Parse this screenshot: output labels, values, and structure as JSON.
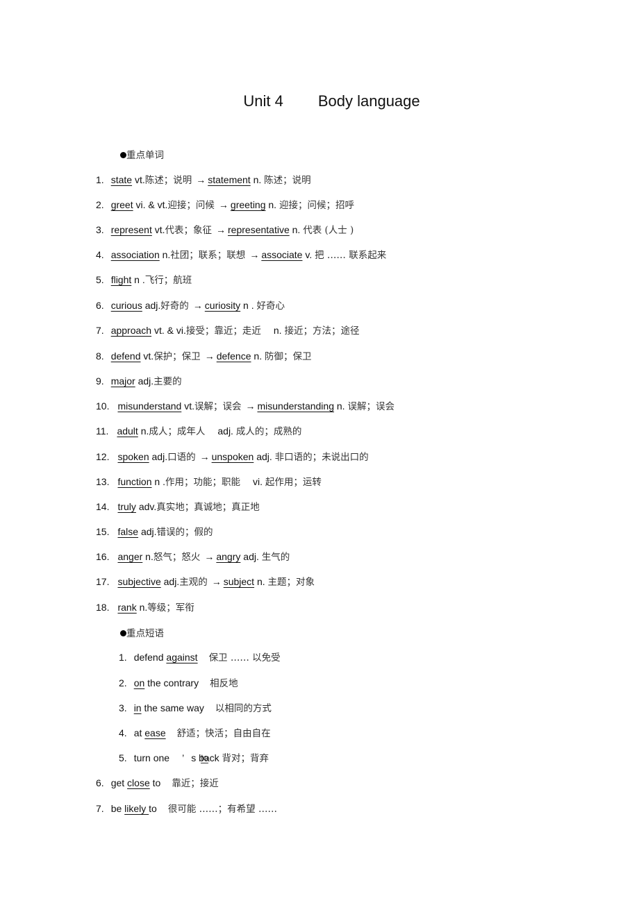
{
  "title": {
    "unit": "Unit 4",
    "topic": "Body language"
  },
  "sections": {
    "words_heading": "重点单词",
    "phrases_heading": "重点短语"
  },
  "words": [
    {
      "num": "1.",
      "word": "state",
      "pos": "vt.",
      "meaning": "陈述；说明",
      "arrow": "→",
      "derived": "statement",
      "dpos": "n.",
      "dmeaning": "陈述；说明"
    },
    {
      "num": "2.",
      "word": "greet",
      "pos": "vi. & vt.",
      "meaning": "迎接；问候",
      "arrow": "→",
      "derived": "greeting",
      "dpos": "n.",
      "dmeaning": "迎接；问候；招呼"
    },
    {
      "num": "3.",
      "word": "represent",
      "pos": "vt.",
      "meaning": "代表；象征",
      "arrow": "→",
      "derived": "representative",
      "dpos": "n.",
      "dmeaning": "代表 (人士 )"
    },
    {
      "num": "4.",
      "word": "association",
      "pos": "n.",
      "meaning": "社团；联系；联想",
      "arrow": "→",
      "derived": "associate",
      "dpos": "v.",
      "dmeaning": "把 …… 联系起来"
    },
    {
      "num": "5.",
      "word": "flight",
      "pos": "n .",
      "meaning": "飞行；航班"
    },
    {
      "num": "6.",
      "word": "curious",
      "pos": "adj.",
      "meaning": "好奇的",
      "arrow": "→",
      "derived": "curiosity",
      "dpos": "n .",
      "dmeaning": "好奇心"
    },
    {
      "num": "7.",
      "word": "approach",
      "pos": "vt. & vi.",
      "meaning": "接受；靠近；走近",
      "pos2": "n.",
      "meaning2": "接近；方法；途径"
    },
    {
      "num": "8.",
      "word": "defend",
      "pos": "vt.",
      "meaning": "保护；保卫",
      "arrow": "→",
      "derived": "defence",
      "dpos": "n.",
      "dmeaning": "防御；保卫"
    },
    {
      "num": "9.",
      "word": "major",
      "pos": "adj.",
      "meaning": "主要的"
    },
    {
      "num": "10.",
      "word": "misunderstand",
      "pos": "vt.",
      "meaning": "误解；误会",
      "arrow": "→",
      "derived": "misunderstanding",
      "dpos": "n.",
      "dmeaning": "误解；误会"
    },
    {
      "num": "11.",
      "word": "adult",
      "pos": "n.",
      "meaning": "成人；成年人",
      "pos2": "adj.",
      "meaning2": "成人的；成熟的"
    },
    {
      "num": "12.",
      "word": "spoken",
      "pos": "adj.",
      "meaning": "口语的",
      "arrow": "→",
      "derived": "unspoken",
      "dpos": "adj.",
      "dmeaning": "非口语的；未说出口的"
    },
    {
      "num": "13.",
      "word": "function",
      "pos": "n .",
      "meaning": "作用；功能；职能",
      "pos2": "vi.",
      "meaning2": "起作用；运转"
    },
    {
      "num": "14.",
      "word": "truly",
      "pos": "adv.",
      "meaning": "真实地；真诚地；真正地"
    },
    {
      "num": "15.",
      "word": "false",
      "pos": "adj.",
      "meaning": "错误的；假的"
    },
    {
      "num": "16.",
      "word": "anger",
      "pos": "n.",
      "meaning": "怒气；怒火",
      "arrow": "→",
      "derived": "angry",
      "dpos": "adj.",
      "dmeaning": "生气的"
    },
    {
      "num": "17.",
      "word": "subjective",
      "pos": "adj.",
      "meaning": "主观的",
      "arrow": "→",
      "derived": "subject",
      "dpos": "n.",
      "dmeaning": "主题；对象"
    },
    {
      "num": "18.",
      "word": "rank",
      "pos": "n.",
      "meaning": "等级；军衔"
    }
  ],
  "phrases": [
    {
      "num": "1.",
      "pre": "defend ",
      "blank": "against",
      "post": "",
      "meaning": "保卫 …… 以免受"
    },
    {
      "num": "2.",
      "pre": "",
      "blank": "on",
      "post": " the contrary",
      "meaning": "相反地"
    },
    {
      "num": "3.",
      "pre": "",
      "blank": "in",
      "post": " the same way",
      "meaning": "以相同的方式"
    },
    {
      "num": "4.",
      "pre": "at ",
      "blank": "ease",
      "post": "",
      "meaning": "舒适；快活；自由自在"
    },
    {
      "num": "5.",
      "pre": "turn one",
      "apostrophe": "’",
      "s_part": "s ",
      "back": "back",
      "blank": "to",
      "meaning": "背对；背弃"
    },
    {
      "num": "6.",
      "pre": "get ",
      "blank": "close",
      "post": " to",
      "meaning": "靠近；接近"
    },
    {
      "num": "7.",
      "pre": "be ",
      "blank": "likely ",
      "post": "to",
      "meaning": "很可能 ……；有希望 ……"
    }
  ]
}
